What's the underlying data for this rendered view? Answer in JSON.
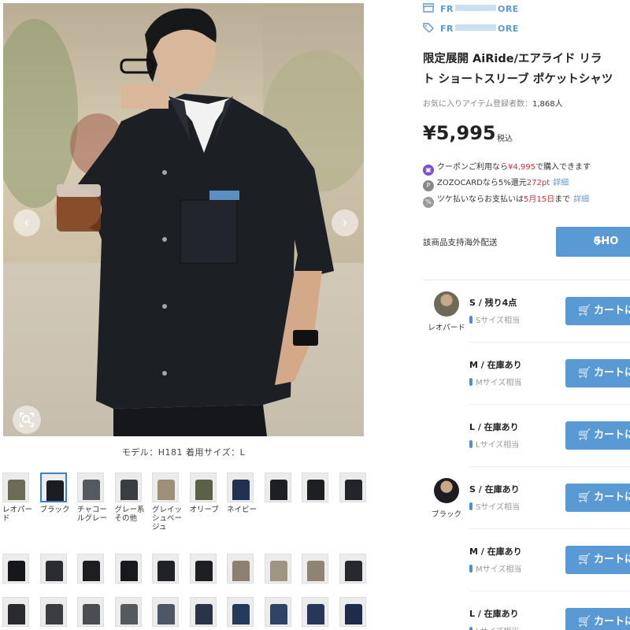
{
  "gallery": {
    "prev_label": "‹",
    "next_label": "›",
    "caption": "モデル：H181 着用サイズ：L",
    "colors": {
      "background": "#c9bda5",
      "shirt": "#1c1f24"
    },
    "row1_thumbs": [
      {
        "label": "レオパード",
        "tone": "#6d6a55"
      },
      {
        "label": "ブラック",
        "tone": "#1b1d22"
      },
      {
        "label": "チャコールグレー",
        "tone": "#555a60"
      },
      {
        "label": "グレー系その他",
        "tone": "#3a3d42"
      },
      {
        "label": "グレイッシュベージュ",
        "tone": "#9e8f78"
      },
      {
        "label": "オリーブ",
        "tone": "#5a6147"
      },
      {
        "label": "ネイビー",
        "tone": "#223150"
      },
      {
        "label": "",
        "tone": "#1e1f23"
      },
      {
        "label": "",
        "tone": "#1e1f23"
      },
      {
        "label": "",
        "tone": "#23252a"
      }
    ],
    "row2_thumbs": [
      "#15171b",
      "#2a2c30",
      "#1c1e22",
      "#17191d",
      "#202226",
      "#1d1f23",
      "#8c8070",
      "#a09483",
      "#8f8474",
      "#27292e"
    ],
    "row3_thumbs": [
      "#2a2b2f",
      "#3a3c40",
      "#4a4d52",
      "#555a5f",
      "#4c5866",
      "#2a3448",
      "#243a5a",
      "#2e4466",
      "#26375a",
      "#1e2c4a"
    ]
  },
  "product": {
    "brand_name": "FR…ORE",
    "store_name": "FR…ORE",
    "brand_prefix": "FR",
    "brand_suffix": "ORE",
    "title_line1": "限定展開 AiRide/エアライド リラ",
    "title_line2": "ト ショートスリーブ ポケットシャツ",
    "favorites_label": "お気に入りアイテム登録者数：",
    "favorites_count": "1,868人",
    "price": "¥5,995",
    "tax_label": "税込",
    "promos": [
      {
        "icon": "coupon",
        "pre": "クーポンご利用なら",
        "highlight": "¥4,995",
        "post": "で購入できます",
        "link": ""
      },
      {
        "icon": "p",
        "pre": "ZOZOCARDなら5%還元",
        "highlight": "272pt",
        "post": "",
        "link": "詳細"
      },
      {
        "icon": "tsuke",
        "pre": "ツケ払いならお支払いは",
        "highlight": "5月15日",
        "post": "まで",
        "link": "詳細"
      }
    ],
    "shipping_label": "該商品支持海外配送",
    "shipping_button": "SHO",
    "accent_color": "#5a9ad4",
    "sale_color": "#c8323c"
  },
  "stock": [
    {
      "color_name": "レオパード",
      "sizes": [
        {
          "size": "S / 残り4点",
          "hint": "Sサイズ相当",
          "button": "カートに"
        },
        {
          "size": "M / 在庫あり",
          "hint": "Mサイズ相当",
          "button": "カートに"
        },
        {
          "size": "L / 在庫あり",
          "hint": "Lサイズ相当",
          "button": "カートに"
        }
      ]
    },
    {
      "color_name": "ブラック",
      "sizes": [
        {
          "size": "S / 在庫あり",
          "hint": "Sサイズ相当",
          "button": "カートに"
        },
        {
          "size": "M / 在庫あり",
          "hint": "Mサイズ相当",
          "button": "カートに"
        },
        {
          "size": "L / 在庫あり",
          "hint": "Lサイズ相当",
          "button": "カートに"
        }
      ]
    }
  ]
}
